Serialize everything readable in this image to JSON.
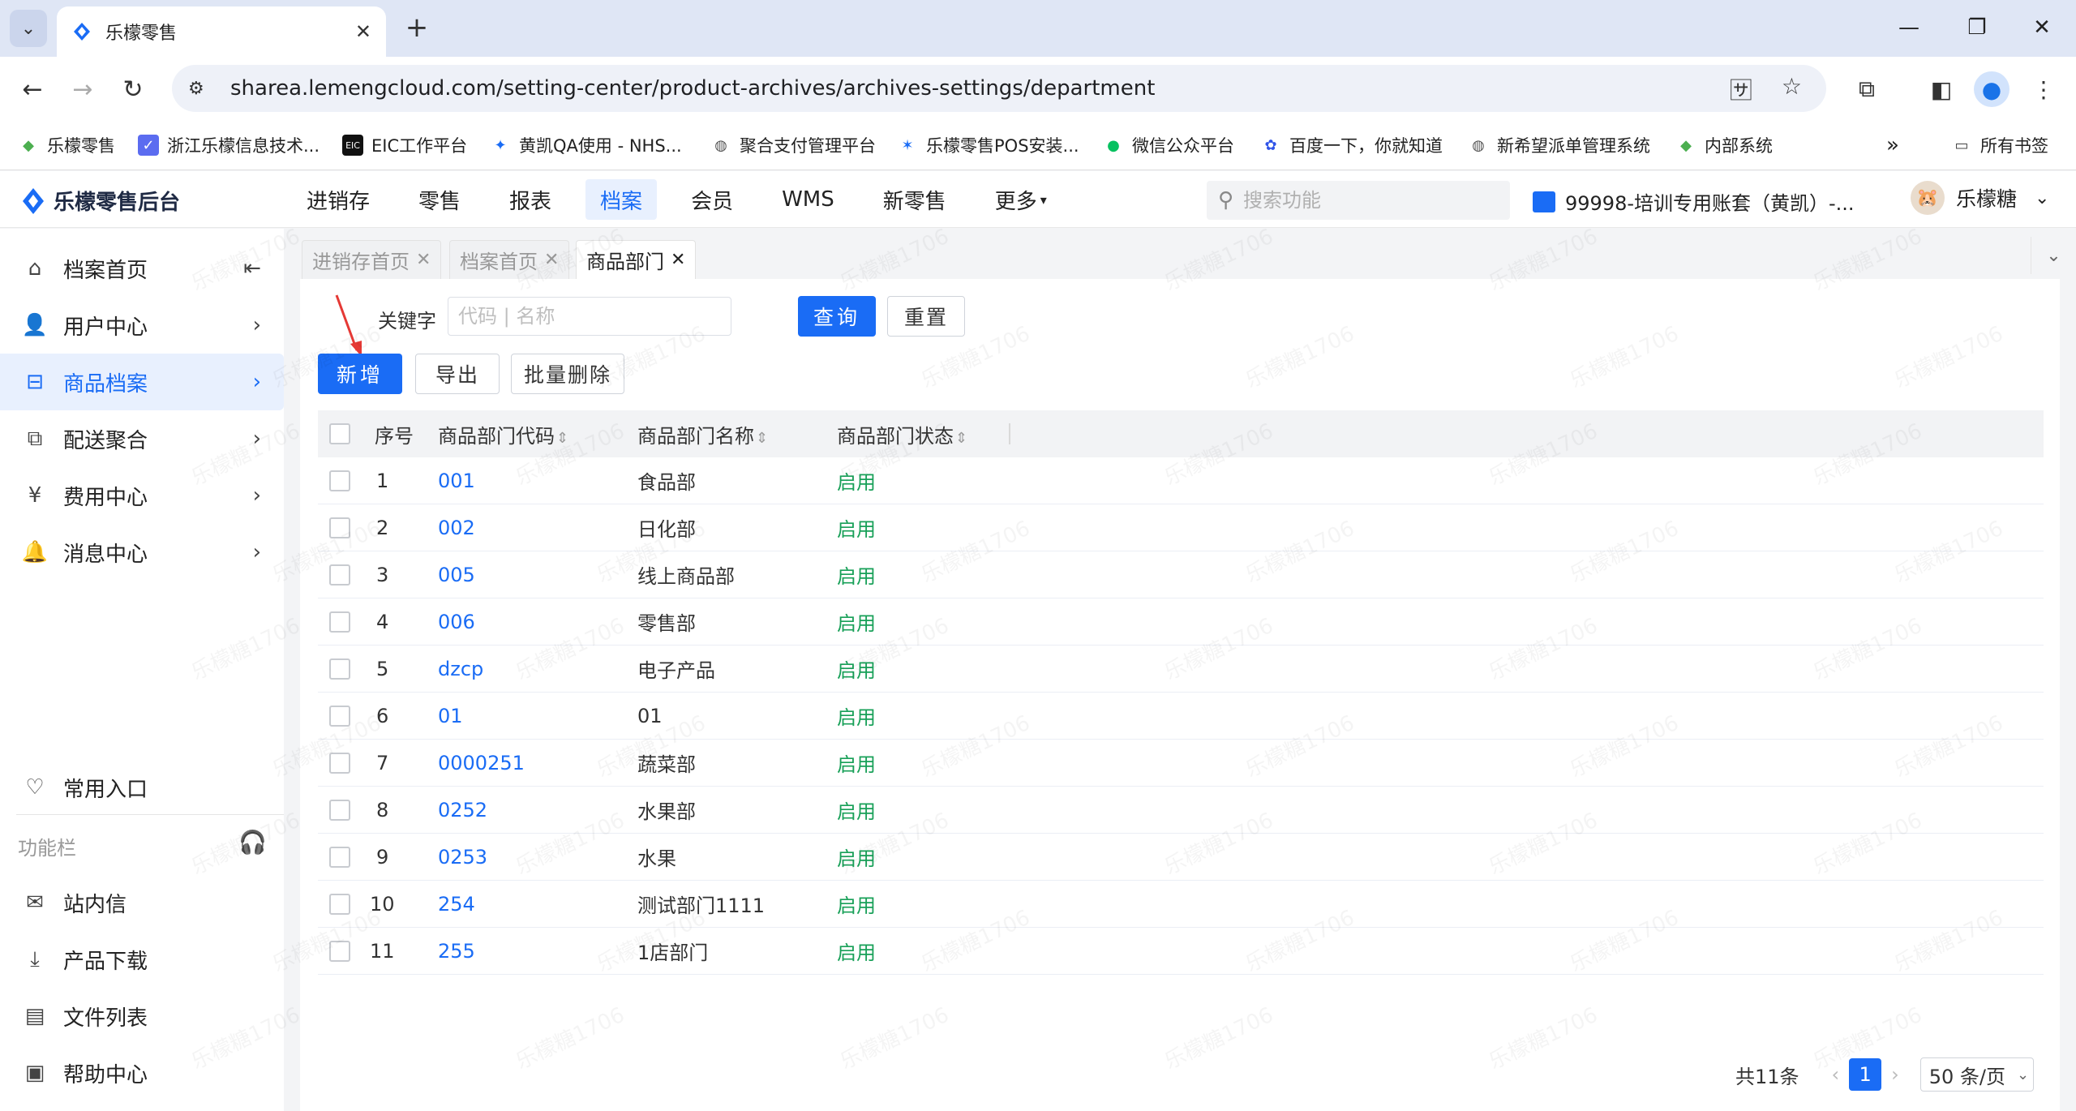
{
  "browser": {
    "tab_title": "乐檬零售",
    "url": "sharea.lemengcloud.com/setting-center/product-archives/archives-settings/department",
    "bookmarks": [
      {
        "label": "乐檬零售"
      },
      {
        "label": "浙江乐檬信息技术..."
      },
      {
        "label": "EIC工作平台"
      },
      {
        "label": "黄凯QA使用 - NHS..."
      },
      {
        "label": "聚合支付管理平台"
      },
      {
        "label": "乐檬零售POS安装..."
      },
      {
        "label": "微信公众平台"
      },
      {
        "label": "百度一下，你就知道"
      },
      {
        "label": "新希望派单管理系统"
      },
      {
        "label": "内部系统"
      }
    ],
    "more_bookmarks": "»",
    "all_bookmarks": "所有书签"
  },
  "header": {
    "logo": "乐檬零售后台",
    "nav": [
      {
        "label": "进销存"
      },
      {
        "label": "零售"
      },
      {
        "label": "报表"
      },
      {
        "label": "档案"
      },
      {
        "label": "会员"
      },
      {
        "label": "WMS"
      },
      {
        "label": "新零售"
      },
      {
        "label": "更多"
      }
    ],
    "search_placeholder": "搜索功能",
    "account": "99998-培训专用账套（黄凯）-...",
    "user": "乐檬糖"
  },
  "sidebar": {
    "items": [
      {
        "label": "档案首页"
      },
      {
        "label": "用户中心"
      },
      {
        "label": "商品档案"
      },
      {
        "label": "配送聚合"
      },
      {
        "label": "费用中心"
      },
      {
        "label": "消息中心"
      }
    ],
    "favorites": "常用入口",
    "section": "功能栏",
    "tools": [
      {
        "label": "站内信"
      },
      {
        "label": "产品下载"
      },
      {
        "label": "文件列表"
      },
      {
        "label": "帮助中心"
      }
    ]
  },
  "page_tabs": [
    {
      "label": "进销存首页"
    },
    {
      "label": "档案首页"
    },
    {
      "label": "商品部门"
    }
  ],
  "filter": {
    "keyword_label": "关键字",
    "keyword_placeholder": "代码 | 名称",
    "query_btn": "查询",
    "reset_btn": "重置"
  },
  "actions": {
    "add_btn": "新增",
    "export_btn": "导出",
    "batch_delete_btn": "批量删除"
  },
  "table": {
    "headers": {
      "index": "序号",
      "code": "商品部门代码",
      "name": "商品部门名称",
      "status": "商品部门状态"
    },
    "rows": [
      {
        "index": "1",
        "code": "001",
        "name": "食品部",
        "status": "启用"
      },
      {
        "index": "2",
        "code": "002",
        "name": "日化部",
        "status": "启用"
      },
      {
        "index": "3",
        "code": "005",
        "name": "线上商品部",
        "status": "启用"
      },
      {
        "index": "4",
        "code": "006",
        "name": "零售部",
        "status": "启用"
      },
      {
        "index": "5",
        "code": "dzcp",
        "name": "电子产品",
        "status": "启用"
      },
      {
        "index": "6",
        "code": "01",
        "name": "01",
        "status": "启用"
      },
      {
        "index": "7",
        "code": "0000251",
        "name": "蔬菜部",
        "status": "启用"
      },
      {
        "index": "8",
        "code": "0252",
        "name": "水果部",
        "status": "启用"
      },
      {
        "index": "9",
        "code": "0253",
        "name": "水果",
        "status": "启用"
      },
      {
        "index": "10",
        "code": "254",
        "name": "测试部门1111",
        "status": "启用"
      },
      {
        "index": "11",
        "code": "255",
        "name": "1店部门",
        "status": "启用"
      }
    ]
  },
  "pagination": {
    "total": "共11条",
    "current_page": "1",
    "page_size": "50 条/页"
  },
  "watermark": "乐檬糖1706",
  "colors": {
    "primary": "#1a6cf5",
    "status_enabled": "#18a058",
    "arrow": "#e53935"
  }
}
